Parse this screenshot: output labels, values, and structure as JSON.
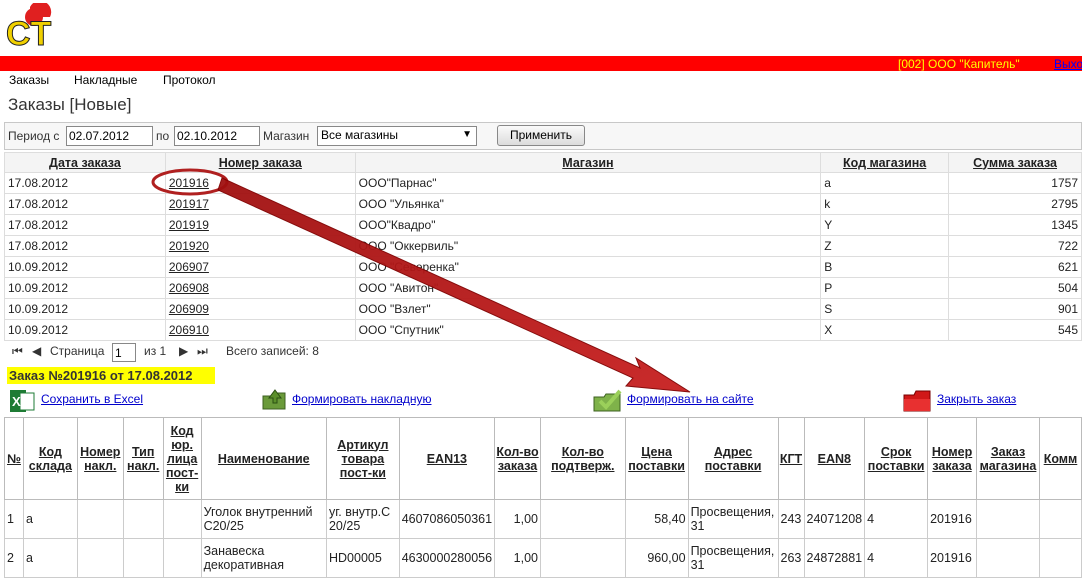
{
  "header": {
    "logo_text": "CT",
    "company": "[002] ООО \"Капитель\"",
    "exit_label": "Выход"
  },
  "menu": [
    "Заказы",
    "Накладные",
    "Протокол"
  ],
  "page_title": "Заказы [Новые]",
  "filter": {
    "period_from_label": "Период с",
    "period_from_value": "02.07.2012",
    "period_to_label": "по",
    "period_to_value": "02.10.2012",
    "store_label": "Магазин",
    "store_value": "Все магазины",
    "apply_label": "Применить"
  },
  "orders": {
    "columns": [
      "Дата заказа",
      "Номер заказа",
      "Магазин",
      "Код магазина",
      "Сумма заказа"
    ],
    "rows": [
      [
        "17.08.2012",
        "201916",
        "ООО\"Парнас\"",
        "a",
        "1757"
      ],
      [
        "17.08.2012",
        "201917",
        "ООО \"Ульянка\"",
        "k",
        "2795"
      ],
      [
        "17.08.2012",
        "201919",
        "ООО\"Квадро\"",
        "Y",
        "1345"
      ],
      [
        "17.08.2012",
        "201920",
        "ООО \"Оккервиль\"",
        "Z",
        "722"
      ],
      [
        "10.09.2012",
        "206907",
        "ООО \"Северенка\"",
        "B",
        "621"
      ],
      [
        "10.09.2012",
        "206908",
        "ООО \"Авитон\"",
        "P",
        "504"
      ],
      [
        "10.09.2012",
        "206909",
        "ООО \"Взлет\"",
        "S",
        "901"
      ],
      [
        "10.09.2012",
        "206910",
        "ООО \"Спутник\"",
        "X",
        "545"
      ]
    ]
  },
  "pager": {
    "page_label": "Страница",
    "page_value": "1",
    "of_label": "из 1",
    "total_label": "Всего записей: 8"
  },
  "order_detail": {
    "title": "Заказ №201916 от 17.08.2012",
    "actions": {
      "excel": "Сохранить в Excel",
      "invoice": "Формировать накладную",
      "site": "Формировать на сайте",
      "close": "Закрыть заказ"
    },
    "columns": [
      "№",
      "Код склада",
      "Номер накл.",
      "Тип накл.",
      "Код юр. лица пост-ки",
      "Наименование",
      "Артикул товара пост-ки",
      "EAN13",
      "Кол-во заказа",
      "Кол-во подтверж.",
      "Цена поставки",
      "Адрес поставки",
      "КГТ",
      "EAN8",
      "Срок поставки",
      "Номер заказа",
      "Заказ магазина",
      "Комм"
    ],
    "rows": [
      [
        "1",
        "a",
        "",
        "",
        "",
        "Уголок внутренний С20/25",
        "уг. внутр.С 20/25",
        "4607086050361",
        "1,00",
        "",
        "58,40",
        "Просвещения, 31",
        "243",
        "24071208",
        "4",
        "201916",
        "",
        ""
      ],
      [
        "2",
        "a",
        "",
        "",
        "",
        "Занавеска декоративная",
        "HD00005",
        "4630000280056",
        "1,00",
        "",
        "960,00",
        "Просвещения, 31",
        "263",
        "24872881",
        "4",
        "201916",
        "",
        ""
      ]
    ]
  }
}
